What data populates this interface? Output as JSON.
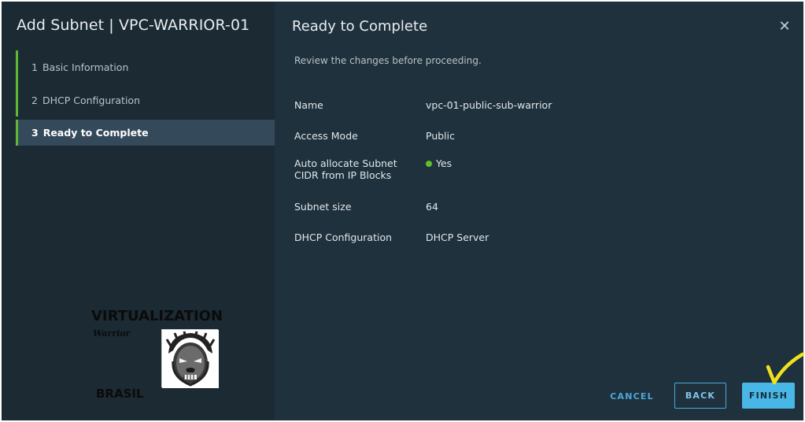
{
  "wizard": {
    "title": "Add Subnet | VPC-WARRIOR-01",
    "steps": [
      {
        "num": "1",
        "label": "Basic Information",
        "active": false
      },
      {
        "num": "2",
        "label": "DHCP Configuration",
        "active": false
      },
      {
        "num": "3",
        "label": "Ready to Complete",
        "active": true
      }
    ]
  },
  "logo": {
    "line1": "VIRTUALIZATION",
    "line2": "Warrior",
    "line3": "BRASIL"
  },
  "page": {
    "title": "Ready to Complete",
    "subtitle": "Review the changes before proceeding.",
    "close_icon": "close-icon"
  },
  "review": {
    "rows": [
      {
        "key": "Name",
        "value": "vpc-01-public-sub-warrior"
      },
      {
        "key": "Access Mode",
        "value": "Public"
      },
      {
        "key": "Auto allocate Subnet\nCIDR from IP Blocks",
        "key_line1": "Auto allocate Subnet",
        "key_line2": "CIDR from IP Blocks",
        "value": "Yes",
        "status_color": "#5fbf2f"
      },
      {
        "key": "Subnet size",
        "value": "64"
      },
      {
        "key": "DHCP Configuration",
        "value": "DHCP Server"
      }
    ]
  },
  "footer": {
    "cancel_label": "CANCEL",
    "back_label": "BACK",
    "finish_label": "FINISH"
  },
  "colors": {
    "accent": "#48b7e6",
    "step_marker": "#5fb834",
    "annotation": "#f3e11f"
  }
}
